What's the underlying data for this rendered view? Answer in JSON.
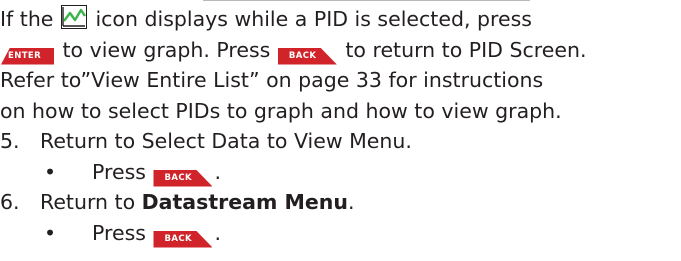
{
  "lines": {
    "l1_a": "If the ",
    "l1_b": " icon displays while a PID is selected, press",
    "l2_a": " to view graph. Press ",
    "l2_b": " to return to PID Screen.",
    "l3": "Refer to”View Entire List” on page 33 for instructions",
    "l4": "on how to select PIDs to graph and how to view graph."
  },
  "steps": [
    {
      "num": "5.",
      "text": "Return to Select Data to View Menu.",
      "bullet": "•",
      "action": "Press ",
      "tail": "."
    },
    {
      "num": "6.",
      "text_a": "Return to ",
      "text_bold": "Datastream Menu",
      "text_b": ".",
      "bullet": "•",
      "action": "Press ",
      "tail": "."
    }
  ],
  "keys": {
    "enter": "ENTER",
    "back": "BACK"
  },
  "icons": {
    "graph": "graph-icon"
  },
  "colors": {
    "key_bg": "#d1232a",
    "graph_line": "#39b54a"
  }
}
